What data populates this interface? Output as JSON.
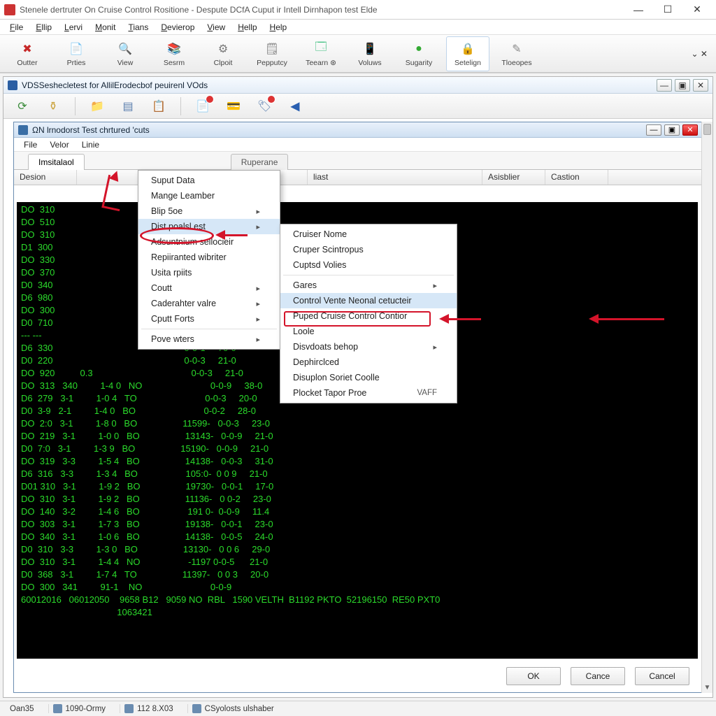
{
  "outer": {
    "title": "Stenele dertruter On Cruise Control Rositione - Despute DCfA Cuput ir Intell Dirnhapon test Elde",
    "menus": [
      "File",
      "Ellip",
      "Lervi",
      "Monit",
      "Tians",
      "Devierop",
      "View",
      "Hellp",
      "Help"
    ],
    "toolbar": [
      {
        "label": "Outter",
        "icon": "✖",
        "color": "#c62828"
      },
      {
        "label": "Prties",
        "icon": "📄",
        "color": "#e6a23c"
      },
      {
        "label": "View",
        "icon": "🔍",
        "color": "#888"
      },
      {
        "label": "Sesrm",
        "icon": "📚",
        "color": "#5b8"
      },
      {
        "label": "Clpoit",
        "icon": "⚙",
        "color": "#777"
      },
      {
        "label": "Pepputcy",
        "icon": "🗒",
        "color": "#777"
      },
      {
        "label": "Teearn ⊛",
        "icon": "🗔",
        "color": "#3b7"
      },
      {
        "label": "Voluws",
        "icon": "📱",
        "color": "#888"
      },
      {
        "label": "Sugarity",
        "icon": "●",
        "color": "#3a3"
      },
      {
        "label": "Setelign",
        "icon": "🔒",
        "color": "#c90",
        "active": true
      },
      {
        "label": "Tloeopes",
        "icon": "✎",
        "color": "#888"
      }
    ]
  },
  "mdi": {
    "title": "VDSSeshecletest for AllilErodecbof peuirenl VOds",
    "subtool_icons": [
      "refresh",
      "filter",
      "|",
      "folder",
      "list",
      "clipboard",
      "|",
      "doc",
      "card",
      "tag",
      "|",
      "back"
    ]
  },
  "doc": {
    "title": "ΩN lrnodorst Test chrtured 'cuts",
    "menus": [
      "File",
      "Velor",
      "Linie"
    ],
    "tabs": [
      "Imsitalaol",
      "Ruperane"
    ],
    "columns": [
      "Desion",
      "",
      "",
      "",
      "",
      "",
      "liast",
      "Asisblier",
      "Castion"
    ]
  },
  "context1": {
    "items": [
      {
        "label": "Suput Data"
      },
      {
        "label": "Mange Leamber"
      },
      {
        "label": "Blip 5oe",
        "arrow": true
      },
      {
        "label": "Dist poalsl est",
        "arrow": true,
        "highlight": true
      },
      {
        "label": "Adsuntnium sellocieir"
      },
      {
        "label": "Repiiranted wibriter"
      },
      {
        "label": "Usita rpiits"
      },
      {
        "label": "Coutt",
        "arrow": true
      },
      {
        "label": "Caderahter valre",
        "arrow": true
      },
      {
        "label": "Cputt Forts",
        "arrow": true
      },
      {
        "sep": true
      },
      {
        "label": "Pove wters",
        "arrow": true
      }
    ]
  },
  "context2": {
    "items": [
      {
        "label": "Cruiser Nome"
      },
      {
        "label": "Cruper Scintropus"
      },
      {
        "label": "Cuptsd Volies"
      },
      {
        "sep": true
      },
      {
        "label": "Gares",
        "arrow": true
      },
      {
        "label": "Control Vente Neonal cetucteir",
        "highlight": true
      },
      {
        "label": "Puped Cruise Control Contior"
      },
      {
        "label": "Loole"
      },
      {
        "label": "Disvdoats behop",
        "arrow": true
      },
      {
        "label": "Dephirclced"
      },
      {
        "label": "Disuplon Soriet Coolle"
      },
      {
        "label": "Plocket Tapor Proe",
        "hint": "VAFF"
      }
    ]
  },
  "terminal_rows": [
    "DO  310                                                    0-0-1     31-0",
    "DO  510                                                    0-0-2     73-0",
    "DO  310                                                    0-0-2     37-0",
    "D1  300                                                    0-2-3     36-0",
    "DO  330                                                    0-0-9     23-0",
    "DO  370                                                    0-0-6     30-0",
    "D0  340                                                    0-0-1     10-0",
    "D6  980                                                    0-0-6     20-0",
    "DO  300                                                    0-0-4     28-0",
    "D0  710                                                    0-0-2     21-2",
    "--- ---                                                    -- - -   --_--",
    "D6  330                                                    0-0-1     70-0",
    "D0  220                                                    0-0-3     21-0",
    "DO  920          0.3                                       0-0-3     21-0",
    "",
    "DO  313   340         1-4 0   NO                           0-0-9     38-0",
    "D6  279   3-1         1-0 4   TO                           0-0-3     20-0",
    "D0  3-9   2-1         1-4 0   BO                           0-0-2     28-0",
    "DO  2:0   3-1         1-8 0   BO                  11599-   0-0-3     23-0",
    "DO  219   3-1         1-0 0   BO                  13143-   0-0-9     21-0",
    "D0  7:0   3-1         1-3 9   BO                  15190-   0-0-9     21-0",
    "DO  319   3-3         1-5 4   BO                  14138-   0-0-3     31-0",
    "D6  316   3-3         1-3 4   BO                   105:0-  0 0 9     21-0",
    "D01 310   3-1         1-9 2   BO                  19730-   0-0-1     17-0",
    "DO  310   3-1         1-9 2   BO                  11136-   0 0-2     23-0",
    "DO  140   3-2         1-4 6   BO                   191 0-  0-0-9     11.4",
    "DO  303   3-1         1-7 3   BO                  19138-   0-0-1     23-0",
    "DO  340   3-1         1-0 6   BO                  14138-   0-0-5     24-0",
    "D0  310   3-3         1-3 0   BO                  13130-   0 0 6     29-0",
    "DO  310   3-1         1-4 4   NO                   -1197 0-0-5      21-0",
    "D0  368   3-1         1-7 4   TO                  11397-   0 0 3     20-0",
    "DO  300   341         91-1    NO                           0-0-9",
    "60012016   06012050    9658 B12   9059 NO  RBL   1590 VELTH  B1192 PKTO  52196150  RE50 PXT0",
    "                                      1063421"
  ],
  "buttons": {
    "ok": "OK",
    "cancel1": "Cance",
    "cancel2": "Cancel"
  },
  "status": {
    "cells": [
      "Oan35",
      "1090-Ormy",
      "112 8.X03",
      "CSyolosts ulshaber"
    ]
  }
}
